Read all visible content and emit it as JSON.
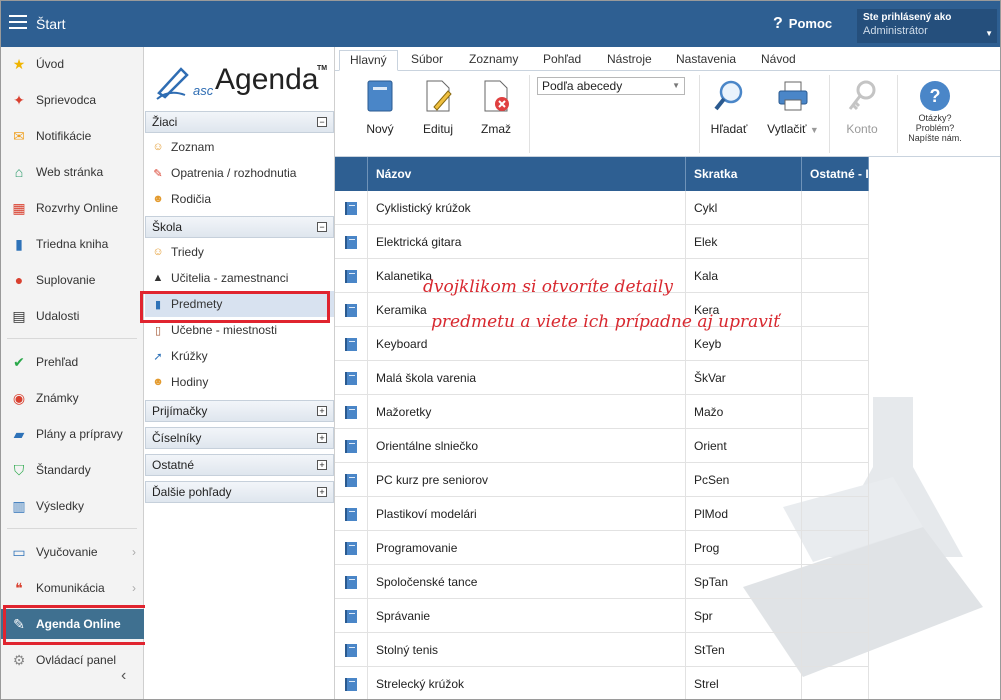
{
  "topbar": {
    "title": "Štart",
    "help_label": "Pomoc",
    "user_line1": "Ste prihlásený ako",
    "user_line2": "Administrátor"
  },
  "sidebar": {
    "items": [
      {
        "label": "Úvod",
        "icon": "star-icon"
      },
      {
        "label": "Sprievodca",
        "icon": "wand-icon"
      },
      {
        "label": "Notifikácie",
        "icon": "envelope-icon"
      },
      {
        "label": "Web stránka",
        "icon": "house-icon"
      },
      {
        "label": "Rozvrhy Online",
        "icon": "timetable-icon"
      },
      {
        "label": "Triedna kniha",
        "icon": "book-icon"
      },
      {
        "label": "Suplovanie",
        "icon": "person-icon"
      },
      {
        "label": "Udalosti",
        "icon": "calendar-icon"
      },
      {
        "label": "Prehľad",
        "icon": "check-icon"
      },
      {
        "label": "Známky",
        "icon": "grade-icon"
      },
      {
        "label": "Plány a prípravy",
        "icon": "briefcase-icon"
      },
      {
        "label": "Štandardy",
        "icon": "shield-icon"
      },
      {
        "label": "Výsledky",
        "icon": "bar-chart-icon"
      },
      {
        "label": "Vyučovanie",
        "icon": "open-book-icon"
      },
      {
        "label": "Komunikácia",
        "icon": "chat-icon"
      },
      {
        "label": "Agenda Online",
        "icon": "pen-icon"
      },
      {
        "label": "Ovládací panel",
        "icon": "gear-icon"
      }
    ]
  },
  "col2": {
    "logo_asc": "asc",
    "logo_agenda": "Agenda",
    "logo_tm": "TM",
    "groups": {
      "ziaci": "Žiaci",
      "skola": "Škola",
      "prijimacky": "Prijímačky",
      "ciselniky": "Číselníky",
      "ostatne": "Ostatné",
      "dalsie": "Ďalšie pohľady"
    },
    "ziaci_items": [
      "Zoznam",
      "Opatrenia / rozhodnutia",
      "Rodičia"
    ],
    "skola_items": [
      "Triedy",
      "Učitelia - zamestnanci",
      "Predmety",
      "Učebne - miestnosti",
      "Krúžky",
      "Hodiny"
    ]
  },
  "ribbon": {
    "tabs": [
      "Hlavný",
      "Súbor",
      "Zoznamy",
      "Pohľad",
      "Nástroje",
      "Nastavenia",
      "Návod"
    ],
    "new_label": "Nový",
    "edit_label": "Edituj",
    "delete_label": "Zmaž",
    "sort_value": "Podľa abecedy",
    "search_label": "Hľadať",
    "print_label": "Vytlačiť",
    "account_label": "Konto",
    "help_text": "Otázky? Problém? Napíšte nám."
  },
  "grid": {
    "columns": [
      "Názov",
      "Skratka",
      "Ostatné - I"
    ],
    "rows": [
      [
        "Cyklistický krúžok",
        "Cykl"
      ],
      [
        "Elektrická gitara",
        "Elek"
      ],
      [
        "Kalanetika",
        "Kala"
      ],
      [
        "Keramika",
        "Kera"
      ],
      [
        "Keyboard",
        "Keyb"
      ],
      [
        "Malá škola varenia",
        "ŠkVar"
      ],
      [
        "Mažoretky",
        "Mažo"
      ],
      [
        "Orientálne slniečko",
        "Orient"
      ],
      [
        "PC kurz pre seniorov",
        "PcSen"
      ],
      [
        "Plastikoví modelári",
        "PlMod"
      ],
      [
        "Programovanie",
        "Prog"
      ],
      [
        "Spoločenské tance",
        "SpTan"
      ],
      [
        "Správanie",
        "Spr"
      ],
      [
        "Stolný tenis",
        "StTen"
      ],
      [
        "Strelecký krúžok",
        "Strel"
      ]
    ]
  },
  "annotation": {
    "line1": "dvojklikom si otvoríte detaily",
    "line2": "predmetu a viete ich prípadne aj upraviť"
  },
  "colors": {
    "header_blue": "#2e5f92",
    "highlight_red": "#e0242f",
    "annotation_red": "#d8282f"
  }
}
